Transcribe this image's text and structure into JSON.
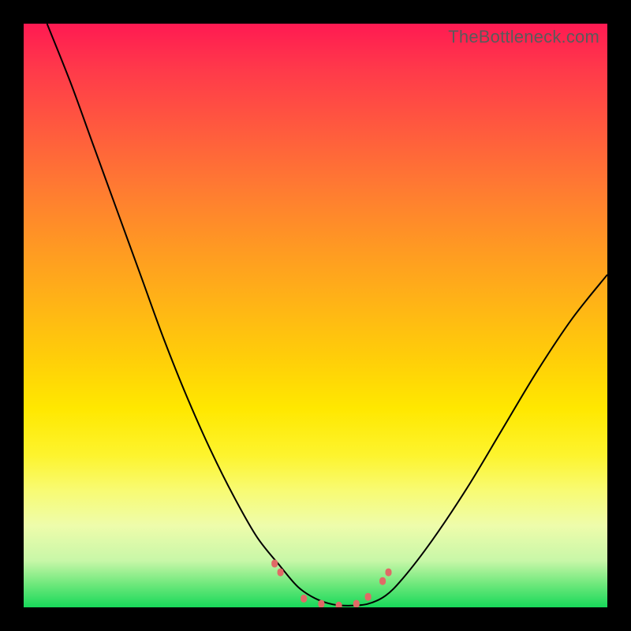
{
  "watermark": "TheBottleneck.com",
  "colors": {
    "gradient_top": "#ff1a52",
    "gradient_mid": "#ffe800",
    "gradient_bottom": "#18d95a",
    "curve": "#000000",
    "markers": "#e06a66",
    "frame": "#000000"
  },
  "chart_data": {
    "type": "line",
    "title": "",
    "xlabel": "",
    "ylabel": "",
    "xlim": [
      0,
      1
    ],
    "ylim": [
      0,
      1
    ],
    "note": "Axes are unitless (no ticks or labels shown). Curve y-values are fraction of plot height from bottom (0=bottom, 1=top). x is fraction of plot width.",
    "series": [
      {
        "name": "bottleneck-curve",
        "x": [
          0.04,
          0.08,
          0.12,
          0.16,
          0.2,
          0.24,
          0.28,
          0.32,
          0.36,
          0.4,
          0.44,
          0.47,
          0.5,
          0.53,
          0.56,
          0.59,
          0.62,
          0.65,
          0.7,
          0.76,
          0.82,
          0.88,
          0.94,
          1.0
        ],
        "y": [
          1.0,
          0.9,
          0.79,
          0.68,
          0.57,
          0.46,
          0.36,
          0.27,
          0.19,
          0.12,
          0.07,
          0.035,
          0.015,
          0.005,
          0.003,
          0.006,
          0.02,
          0.05,
          0.115,
          0.205,
          0.305,
          0.405,
          0.495,
          0.57
        ]
      }
    ],
    "markers": {
      "name": "highlight-dots",
      "x": [
        0.43,
        0.44,
        0.48,
        0.51,
        0.54,
        0.57,
        0.59,
        0.615,
        0.625
      ],
      "y": [
        0.075,
        0.06,
        0.015,
        0.006,
        0.003,
        0.006,
        0.018,
        0.045,
        0.06
      ]
    }
  }
}
